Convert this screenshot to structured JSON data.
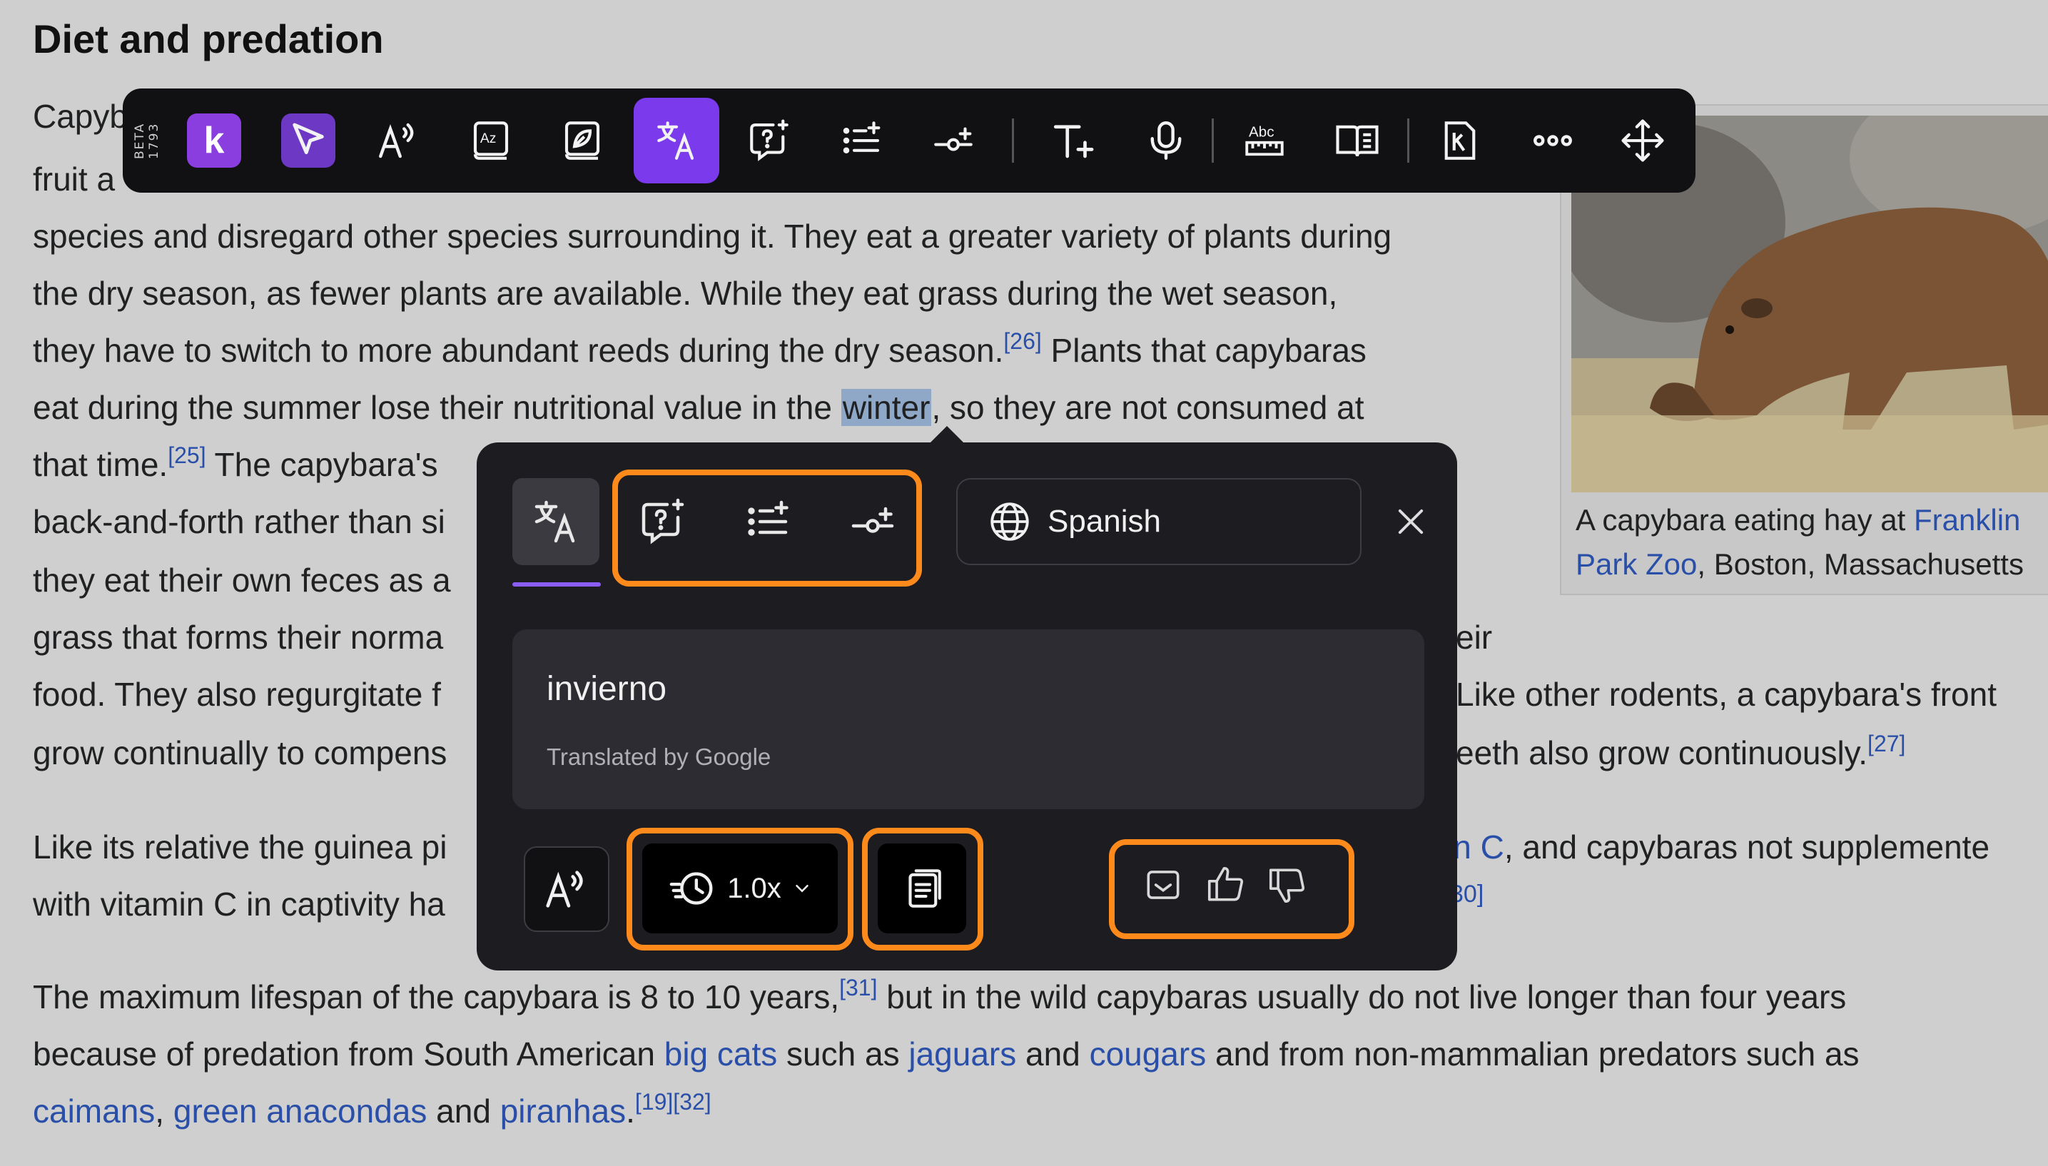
{
  "article": {
    "heading": "Diet and predation",
    "p1": {
      "l1": "Capyb",
      "l2": "fruit a",
      "l3": "species and disregard other species surrounding it. They eat a greater variety of plants during",
      "l4": "the dry season, as fewer plants are available. While they eat grass during the wet season,",
      "l5a": "they have to switch to more abundant reeds during the dry season.",
      "l5ref": "[26]",
      "l5b": " Plants that capybaras",
      "l6a": "eat during the summer lose their nutritional value in the ",
      "l6hl": "winter",
      "l6b": ", so they are not consumed at",
      "l7a": "that time.",
      "l7ref": "[25]",
      "l7b": " The capybara's",
      "l8": "back-and-forth rather than si",
      "l9": "they eat their own feces as a",
      "l10a": "grass that forms their norma",
      "l10b": "eir",
      "l11a": "food. They also regurgitate f",
      "l11b": "Like other rodents, a capybara's front",
      "l12a": "grow continually to compens",
      "l12b": "eeth also grow continuously.",
      "l12ref": "[27]"
    },
    "p2": {
      "l1a": "Like its relative the guinea pi",
      "l1link": "in C",
      "l1b": ", and capybaras not supplemente",
      "l2a": "with vitamin C in captivity ha",
      "l2ref": "30]"
    },
    "p3": {
      "l1a": "The maximum lifespan of the capybara is 8 to 10 years,",
      "l1ref": "[31]",
      "l1b": " but in the wild capybaras usually do not live longer than four years",
      "l2a": "because of predation from South American ",
      "l2link1": "big cats",
      "l2b": " such as ",
      "l2link2": "jaguars",
      "l2c": " and ",
      "l2link3": "cougars",
      "l2d": " and from non-mammalian predators such as",
      "l3link1": "caimans",
      "l3a": ", ",
      "l3link2": "green anacondas",
      "l3b": " and ",
      "l3link3": "piranhas",
      "l3c": ".",
      "l3ref": "[19][32]"
    },
    "figure": {
      "caption_a": "A capybara eating hay at ",
      "caption_link1": "Franklin",
      "caption_link2": "Park Zoo",
      "caption_b": ", Boston, Massachusetts"
    }
  },
  "toolbar": {
    "beta_label": "BETA 1793",
    "logo_letter": "k",
    "items": [
      "logo-icon",
      "select-icon",
      "read-aloud-icon",
      "dictionary-icon",
      "simplify-icon",
      "translate-icon",
      "ask-icon",
      "summarize-icon",
      "explain-icon",
      "text-format-icon",
      "microphone-icon",
      "spelling-icon",
      "reader-icon",
      "kami-icon",
      "more-icon",
      "move-icon"
    ],
    "ruler_label": "Abc"
  },
  "popup": {
    "tabs": [
      "translate-icon",
      "ask-icon",
      "summarize-icon",
      "explain-icon"
    ],
    "language": "Spanish",
    "translation": "invierno",
    "credit": "Translated by Google",
    "speed": "1.0x",
    "accent_color": "#ff8a1c",
    "active_color": "#8b5cf6"
  }
}
